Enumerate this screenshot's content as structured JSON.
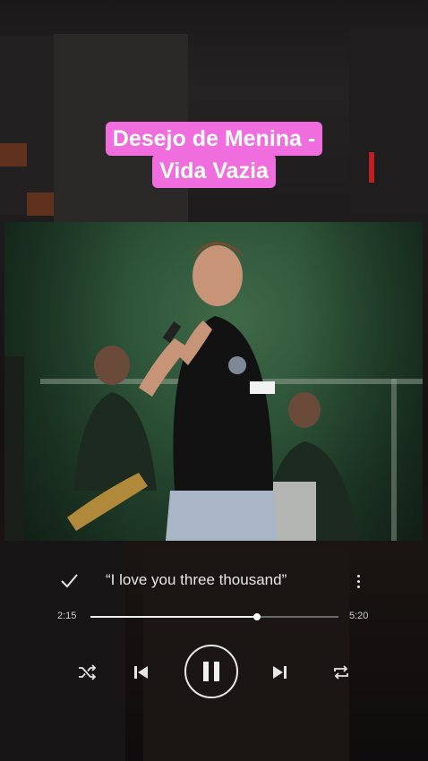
{
  "title": {
    "line1": "Desejo de Menina -",
    "line2": "Vida Vazia"
  },
  "player": {
    "lyric": "“I love you three thousand”",
    "elapsed": "2:15",
    "duration": "5:20",
    "progress_fraction": 0.67,
    "icons": {
      "like": "check-icon",
      "more": "more-vertical-icon",
      "shuffle": "shuffle-icon",
      "previous": "skip-previous-icon",
      "play_pause": "pause-icon",
      "next": "skip-next-icon",
      "repeat": "repeat-icon"
    }
  },
  "colors": {
    "title_bg": "#ef6ddc",
    "accent": "#ffffff"
  }
}
